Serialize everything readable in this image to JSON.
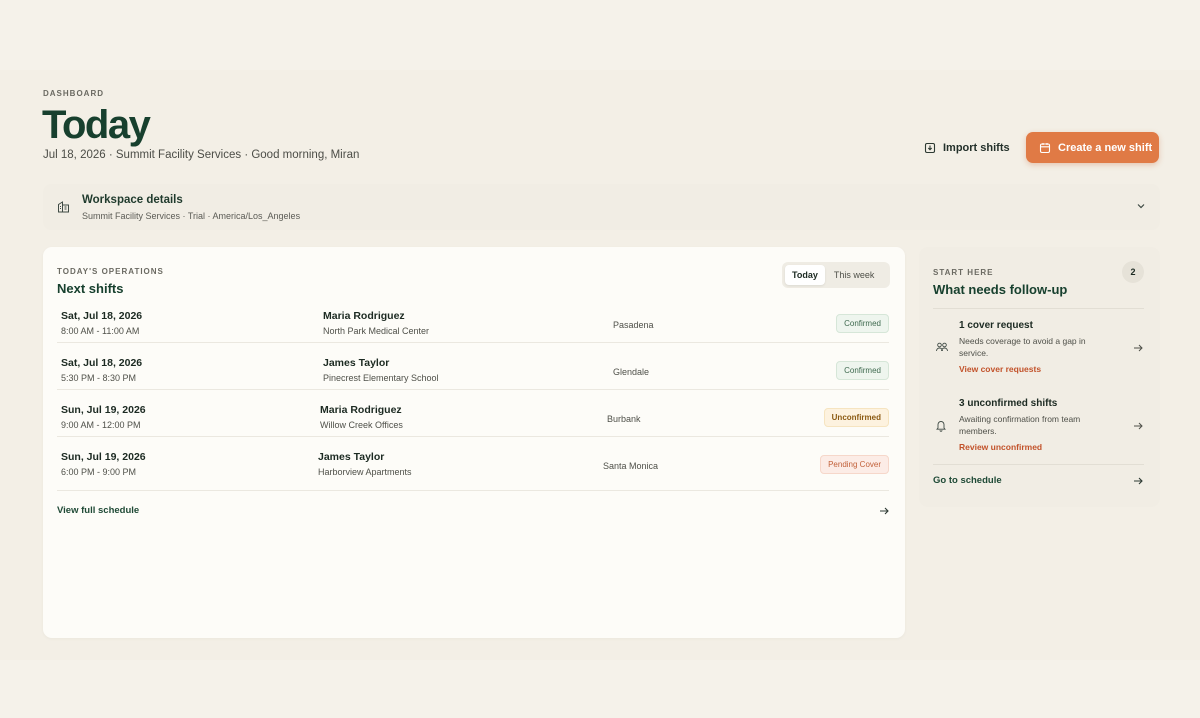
{
  "header": {
    "eyebrow": "DASHBOARD",
    "title": "Today",
    "subtitle": "Jul 18, 2026 · Summit Facility Services · Good morning, Miran",
    "import_label": "Import shifts",
    "create_label": "Create a new shift"
  },
  "workspace": {
    "title": "Workspace details",
    "subtitle": "Summit Facility Services · Trial · America/Los_Angeles"
  },
  "operations": {
    "eyebrow": "TODAY'S OPERATIONS",
    "title": "Next shifts",
    "toggle": [
      "Today",
      "This week"
    ],
    "shifts": [
      {
        "date": "Sat, Jul 18, 2026",
        "time": "8:00 AM - 11:00 AM",
        "person": "Maria Rodriguez",
        "site": "North Park Medical Center",
        "city": "Pasadena",
        "status": "Confirmed"
      },
      {
        "date": "Sat, Jul 18, 2026",
        "time": "5:30 PM - 8:30 PM",
        "person": "James Taylor",
        "site": "Pinecrest Elementary School",
        "city": "Glendale",
        "status": "Confirmed"
      },
      {
        "date": "Sun, Jul 19, 2026",
        "time": "9:00 AM - 12:00 PM",
        "person": "Maria Rodriguez",
        "site": "Willow Creek Offices",
        "city": "Burbank",
        "status": "Unconfirmed"
      },
      {
        "date": "Sun, Jul 19, 2026",
        "time": "6:00 PM - 9:00 PM",
        "person": "James Taylor",
        "site": "Harborview Apartments",
        "city": "Santa Monica",
        "status": "Pending Cover"
      }
    ],
    "view_full": "View full schedule"
  },
  "followup": {
    "eyebrow": "START HERE",
    "title": "What needs follow-up",
    "count": "2",
    "items": [
      {
        "title": "1 cover request",
        "desc": "Needs coverage to avoid a gap in service.",
        "link": "View cover requests",
        "icon": "users-icon"
      },
      {
        "title": "3 unconfirmed shifts",
        "desc": "Awaiting confirmation from team members.",
        "link": "Review unconfirmed",
        "icon": "bell-icon"
      }
    ],
    "goto": "Go to schedule"
  },
  "colors": {
    "accent": "#e07a45",
    "brand_green": "#17402e",
    "link_orange": "#c2522a"
  }
}
